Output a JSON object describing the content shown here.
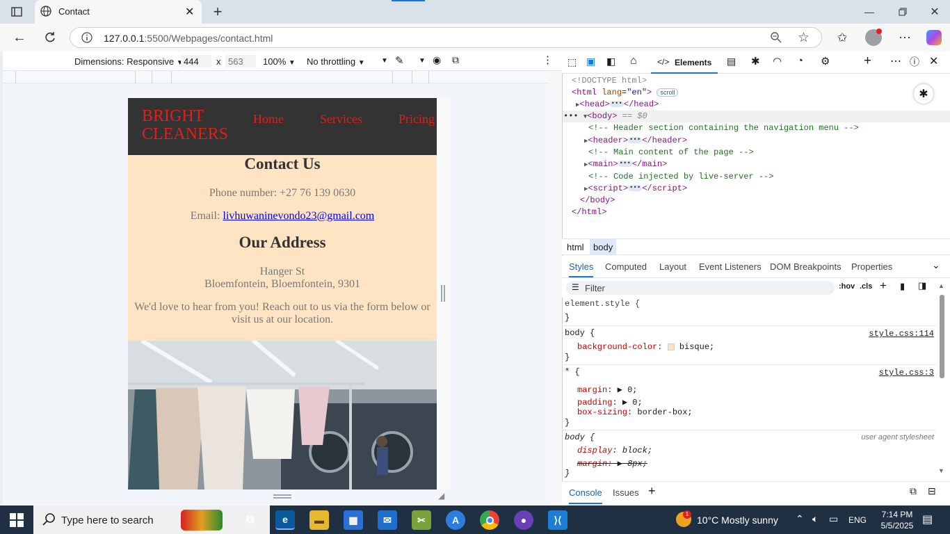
{
  "browser": {
    "tab_title": "Contact",
    "url_host": "127.0.0.1",
    "url_path": ":5500/Webpages/contact.html"
  },
  "device_toolbar": {
    "dimensions_label": "Dimensions: Responsive",
    "width": "444",
    "x": "x",
    "height": "563",
    "zoom": "100%",
    "throttling": "No throttling"
  },
  "site": {
    "brand_line1": "BRIGHT",
    "brand_line2": "CLEANERS",
    "nav": [
      "Home",
      "Services",
      "Pricing"
    ],
    "contact_heading": "Contact Us",
    "phone": "Phone number: +27 76 139 0630",
    "email_label": "Email: ",
    "email_link": "livhuwaninevondo23@gmail.com",
    "address_heading": "Our Address",
    "address_line1": "Hanger St",
    "address_line2": "Bloemfontein, Bloemfontein, 9301",
    "message": "We'd love to hear from you! Reach out to us via the form below or visit us at our location."
  },
  "devtools": {
    "elements_tab": "Elements",
    "dom": {
      "doctype": "<!DOCTYPE html>",
      "scroll_badge": "scroll",
      "eq0": "== $0",
      "comment_header": "<!-- Header section containing the navigation menu -->",
      "comment_main": "<!-- Main content of the page -->",
      "comment_live": "<!-- Code injected by live-server -->"
    },
    "breadcrumbs": [
      "html",
      "body"
    ],
    "style_tabs": [
      "Styles",
      "Computed",
      "Layout",
      "Event Listeners",
      "DOM Breakpoints",
      "Properties"
    ],
    "filter_placeholder": "Filter",
    "hov": ":hov",
    "cls": ".cls",
    "rules": {
      "element_style": "element.style {",
      "close": "}",
      "body_selector": "body {",
      "body_source": "style.css:114",
      "bg_prop": "background-color",
      "bg_value": "bisque;",
      "star_selector": "* {",
      "star_source": "style.css:3",
      "margin_prop": "margin",
      "margin_value": "0;",
      "padding_prop": "padding",
      "padding_value": "0;",
      "boxsizing_prop": "box-sizing",
      "boxsizing_value": "border-box;",
      "ua_selector": "body {",
      "ua_source": "user agent stylesheet",
      "display_prop": "display",
      "display_value": "block;",
      "uamargin_prop": "margin:",
      "uamargin_value": "8px;"
    },
    "drawer_tabs": [
      "Console",
      "Issues"
    ]
  },
  "taskbar": {
    "search_placeholder": "Type here to search",
    "weather": "10°C  Mostly sunny",
    "lang": "ENG",
    "time": "7:14 PM",
    "date": "5/5/2025",
    "notification_count": "1"
  },
  "colors": {
    "page_bg": "#ffe4c4",
    "header_bg": "#333333",
    "brand_red": "#e0201a",
    "accent_blue": "#1a73e8"
  }
}
